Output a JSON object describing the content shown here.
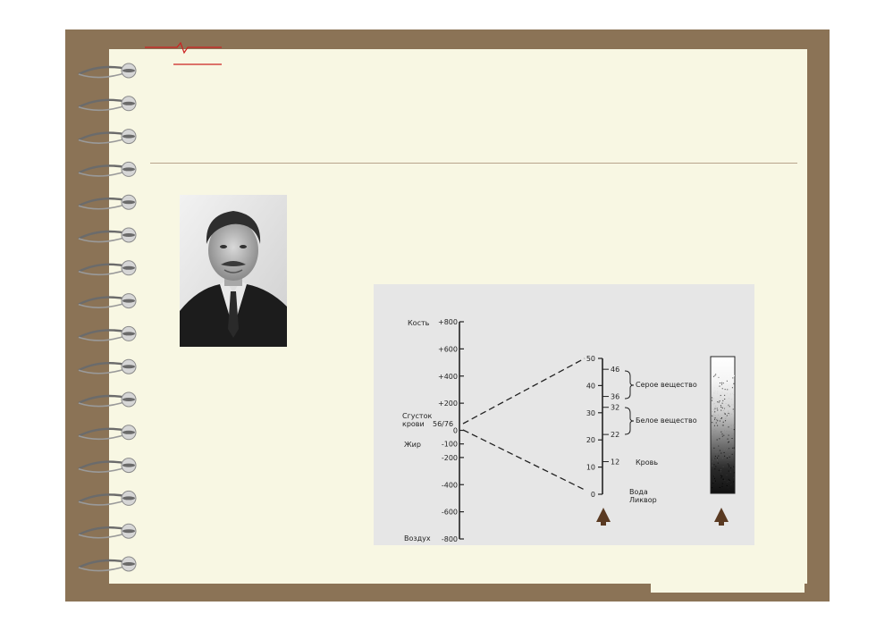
{
  "diagram": {
    "hu_scale": {
      "ticks": [
        "+800",
        "+600",
        "+400",
        "+200",
        "0",
        "-100",
        "-200",
        "-400",
        "-600",
        "-800"
      ],
      "labels": {
        "bone": "Кость",
        "clot_line1": "Сгусток",
        "clot_line2": "крови",
        "clot_value": "56/76",
        "fat": "Жир",
        "air": "Воздух"
      }
    },
    "tissue_scale": {
      "ticks": [
        "50",
        "40",
        "30",
        "20",
        "10",
        "0"
      ],
      "marks": [
        "46",
        "36",
        "32",
        "22",
        "12"
      ],
      "labels": {
        "gray_matter": "Серое вещество",
        "white_matter": "Белое вещество",
        "blood": "Кровь",
        "water_line1": "Вода",
        "water_line2": "Ликвор"
      }
    }
  },
  "colors": {
    "frame": "#8b7356",
    "paper": "#f8f7e3",
    "arrow": "#5a3a22",
    "accent_red": "#cc2222"
  }
}
